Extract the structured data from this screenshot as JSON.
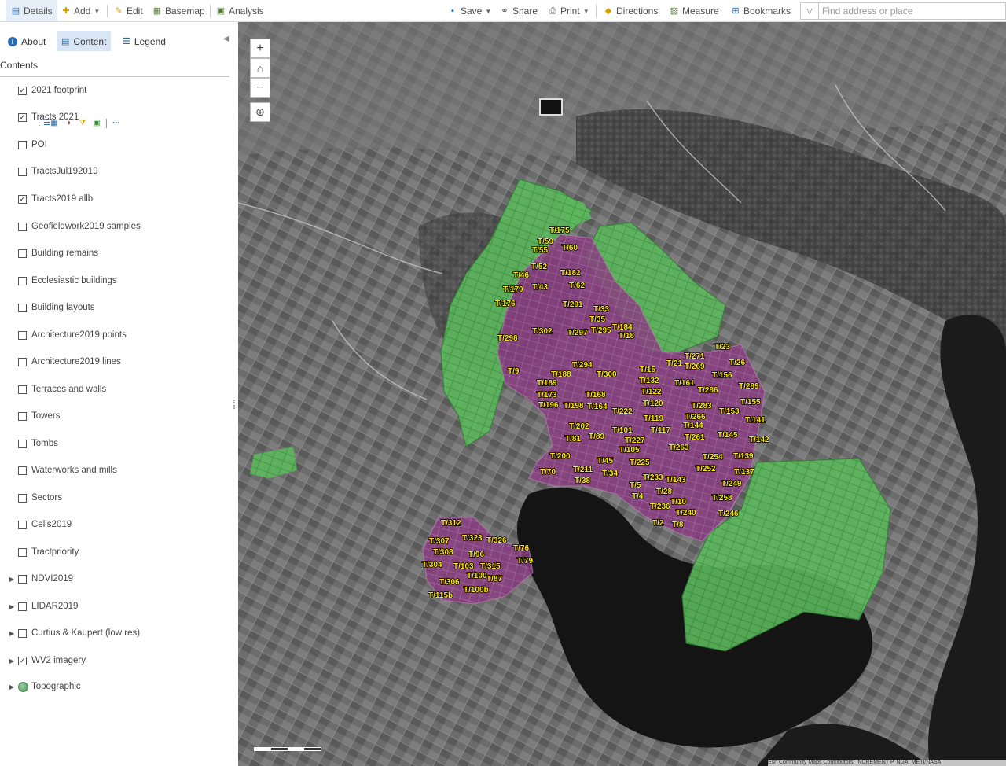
{
  "toolbar": {
    "details": "Details",
    "add": "Add",
    "edit": "Edit",
    "basemap": "Basemap",
    "analysis": "Analysis",
    "save": "Save",
    "share": "Share",
    "print": "Print",
    "directions": "Directions",
    "measure": "Measure",
    "bookmarks": "Bookmarks",
    "search_placeholder": "Find address or place"
  },
  "panel": {
    "tabs": {
      "about": "About",
      "content": "Content",
      "legend": "Legend"
    },
    "contents_heading": "Contents",
    "layers": [
      {
        "name": "2021 footprint",
        "checked": true
      },
      {
        "name": "Tracts 2021",
        "checked": true
      },
      {
        "name": "POI",
        "checked": false
      },
      {
        "name": "TractsJul192019",
        "checked": false
      },
      {
        "name": "Tracts2019 allb",
        "checked": true
      },
      {
        "name": "Geofieldwork2019 samples",
        "checked": false
      },
      {
        "name": "Building remains",
        "checked": false
      },
      {
        "name": "Ecclesiastic buildings",
        "checked": false
      },
      {
        "name": "Building layouts",
        "checked": false
      },
      {
        "name": "Architecture2019 points",
        "checked": false
      },
      {
        "name": "Architecture2019 lines",
        "checked": false
      },
      {
        "name": "Terraces and walls",
        "checked": false
      },
      {
        "name": "Towers",
        "checked": false
      },
      {
        "name": "Tombs",
        "checked": false
      },
      {
        "name": "Waterworks and mills",
        "checked": false
      },
      {
        "name": "Sectors",
        "checked": false
      },
      {
        "name": "Cells2019",
        "checked": false
      },
      {
        "name": "Tractpriority",
        "checked": false
      },
      {
        "name": "NDVI2019",
        "checked": false,
        "expandable": true
      },
      {
        "name": "LIDAR2019",
        "checked": false,
        "expandable": true
      },
      {
        "name": "Curtius & Kaupert (low res)",
        "checked": false,
        "expandable": true
      },
      {
        "name": "WV2 imagery",
        "checked": true,
        "expandable": true
      },
      {
        "name": "Topographic",
        "basemap": true,
        "expandable": true
      }
    ]
  },
  "map": {
    "zoom_in": "+",
    "zoom_out": "−",
    "attribution": "Esri Community Maps Contributors, INCREMENT P, NGA, METI/NASA"
  },
  "tract_labels": [
    "T/175",
    "T/59",
    "T/55",
    "T/60",
    "T/52",
    "T/46",
    "T/182",
    "T/43",
    "T/179",
    "T/62",
    "T/176",
    "T/291",
    "T/33",
    "T/35",
    "T/184",
    "T/295",
    "T/18",
    "T/297",
    "T/302",
    "T/298",
    "T/23",
    "T/271",
    "T/21",
    "T/269",
    "T/26",
    "T/294",
    "T/15",
    "T/9",
    "T/188",
    "T/300",
    "T/156",
    "T/132",
    "T/161",
    "T/289",
    "T/189",
    "T/286",
    "T/122",
    "T/173",
    "T/168",
    "T/155",
    "T/196",
    "T/198",
    "T/164",
    "T/120",
    "T/283",
    "T/153",
    "T/222",
    "T/266",
    "T/119",
    "T/141",
    "T/144",
    "T/202",
    "T/117",
    "T/101",
    "T/89",
    "T/81",
    "T/261",
    "T/145",
    "T/227",
    "T/142",
    "T/263",
    "T/105",
    "T/200",
    "T/254",
    "T/139",
    "T/45",
    "T/225",
    "T/252",
    "T/70",
    "T/211",
    "T/34",
    "T/137",
    "T/233",
    "T/143",
    "T/38",
    "T/5",
    "T/249",
    "T/28",
    "T/4",
    "T/258",
    "T/10",
    "T/236",
    "T/240",
    "T/246",
    "T/2",
    "T/8",
    "T/312",
    "T/323",
    "T/326",
    "T/307",
    "T/308",
    "T/76",
    "T/96",
    "T/304",
    "T/103",
    "T/315",
    "T/79",
    "T/100",
    "T/87",
    "T/306",
    "T/100b",
    "T/115b"
  ]
}
